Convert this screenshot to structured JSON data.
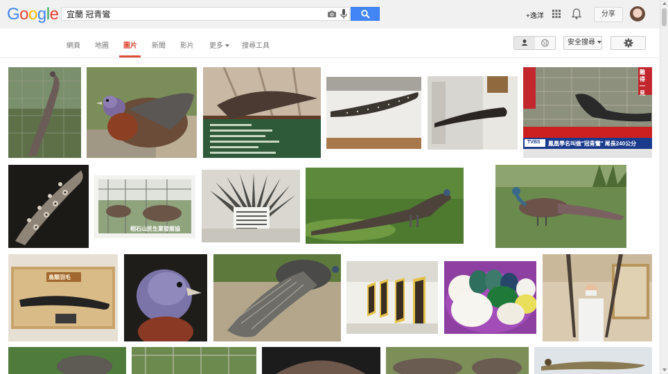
{
  "header": {
    "logo_text": "Google",
    "logo_letters": [
      {
        "ch": "G",
        "color": "#4285f4"
      },
      {
        "ch": "o",
        "color": "#ea4335"
      },
      {
        "ch": "o",
        "color": "#fbbc05"
      },
      {
        "ch": "g",
        "color": "#4285f4"
      },
      {
        "ch": "l",
        "color": "#34a853"
      },
      {
        "ch": "e",
        "color": "#ea4335"
      }
    ],
    "search_query": "宜蘭 冠青鸞",
    "plus_user": "+逸洋",
    "share_label": "分享"
  },
  "nav": {
    "tabs": [
      "網頁",
      "地圖",
      "圖片",
      "新聞",
      "影片",
      "更多",
      "搜尋工具"
    ],
    "active_tab": "圖片",
    "safe_search_label": "安全搜尋"
  },
  "captions": {
    "img4_banner": "鳳凰學名叫做\"冠青鸞\" 尾長240公分",
    "img4_channel": "TVBS",
    "img4_side": "難得一見",
    "img9_caption": "相石山民生業發展協",
    "img14_sign": "鳥類羽毛"
  },
  "colors": {
    "brand_blue": "#4285f4",
    "active_red": "#dd4b39"
  }
}
